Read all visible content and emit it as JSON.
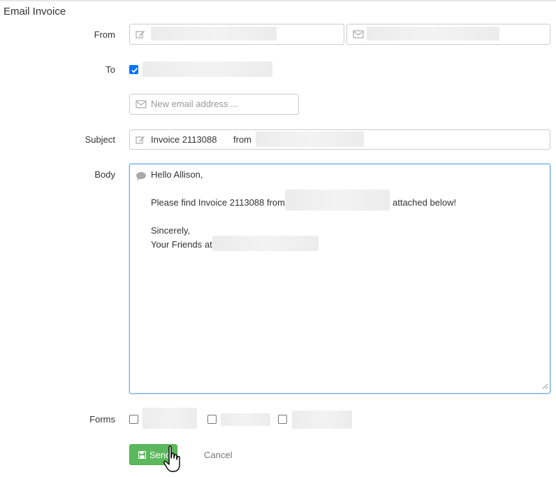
{
  "page": {
    "title": "Email Invoice"
  },
  "from": {
    "label": "From"
  },
  "to": {
    "label": "To",
    "new_email_placeholder": "New email address ..."
  },
  "subject": {
    "label": "Subject",
    "value_prefix": "Invoice 2113088",
    "value_from": "from"
  },
  "body": {
    "label": "Body",
    "greeting": "Hello Allison,",
    "line1_prefix": "Please find Invoice 2113088 from",
    "line1_suffix": "attached below!",
    "closing": "Sincerely,",
    "signature_prefix": "Your Friends at"
  },
  "forms": {
    "label": "Forms"
  },
  "actions": {
    "send_label": "Send",
    "cancel_label": "Cancel"
  },
  "colors": {
    "send_button": "#5cb85c",
    "focus_border": "#66afe9",
    "checkbox_checked": "#0075ff"
  },
  "icons": {
    "from_name": "edit-icon",
    "from_email": "envelope-icon",
    "new_email": "envelope-icon",
    "subject": "edit-icon",
    "body": "comment-icon",
    "send": "floppy-disk-icon"
  }
}
